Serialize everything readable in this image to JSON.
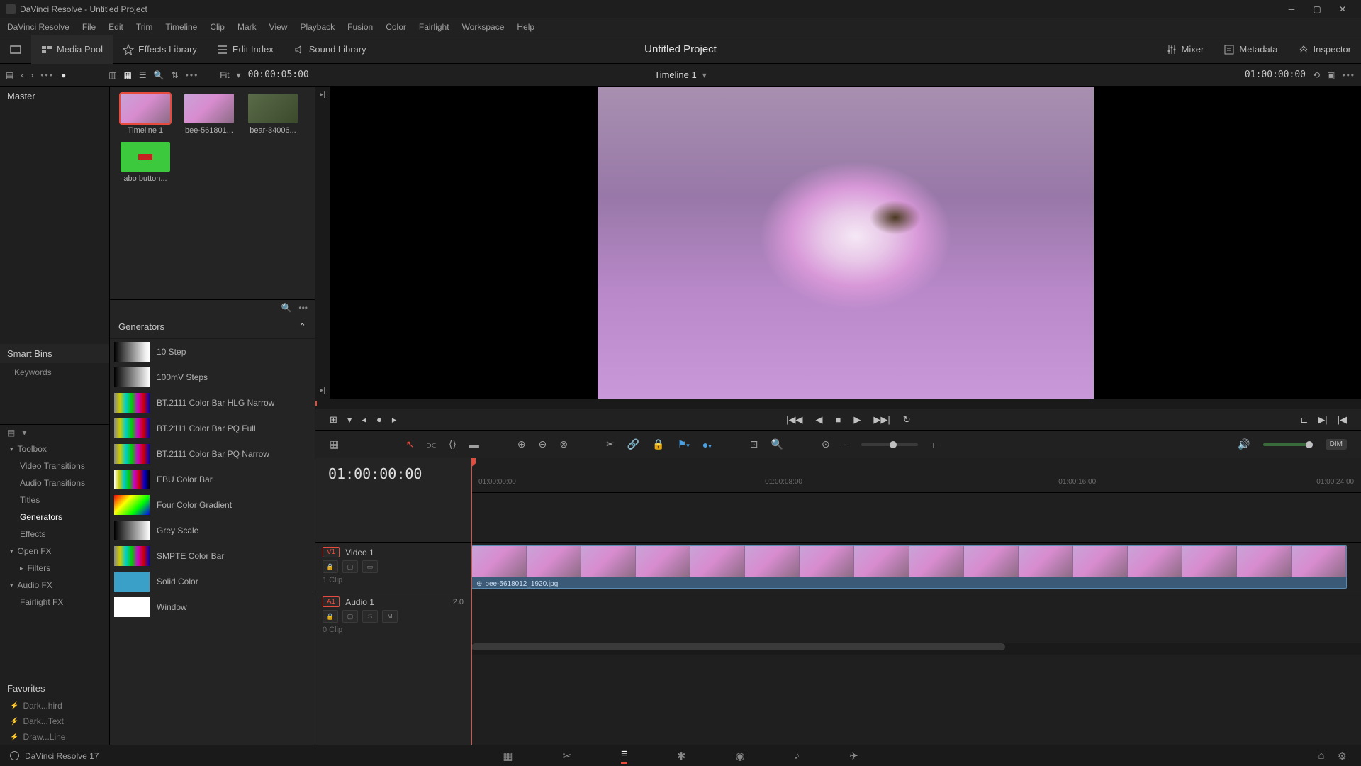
{
  "titlebar": {
    "text": "DaVinci Resolve - Untitled Project"
  },
  "menus": [
    "DaVinci Resolve",
    "File",
    "Edit",
    "Trim",
    "Timeline",
    "Clip",
    "Mark",
    "View",
    "Playback",
    "Fusion",
    "Color",
    "Fairlight",
    "Workspace",
    "Help"
  ],
  "top_tabs": {
    "left": [
      {
        "label": "Media Pool",
        "icon": "media-pool-icon"
      },
      {
        "label": "Effects Library",
        "icon": "effects-icon"
      },
      {
        "label": "Edit Index",
        "icon": "index-icon"
      },
      {
        "label": "Sound Library",
        "icon": "sound-icon"
      }
    ],
    "center": "Untitled Project",
    "right": [
      {
        "label": "Mixer",
        "icon": "mixer-icon"
      },
      {
        "label": "Metadata",
        "icon": "metadata-icon"
      },
      {
        "label": "Inspector",
        "icon": "inspector-icon"
      }
    ]
  },
  "subbar": {
    "fit": "Fit",
    "tc_left": "00:00:05:00",
    "timeline_name": "Timeline 1",
    "tc_right": "01:00:00:00"
  },
  "media": {
    "master": "Master",
    "smartbins": "Smart Bins",
    "keywords": "Keywords",
    "items": [
      {
        "label": "Timeline 1",
        "kind": "flower",
        "sel": true
      },
      {
        "label": "bee-561801...",
        "kind": "flower"
      },
      {
        "label": "bear-34006...",
        "kind": "bear"
      },
      {
        "label": "abo button...",
        "kind": "green"
      }
    ]
  },
  "toolbox": {
    "header": "Toolbox",
    "items": [
      "Video Transitions",
      "Audio Transitions",
      "Titles",
      "Generators",
      "Effects"
    ],
    "selected": "Generators",
    "openfx": "Open FX",
    "filters": "Filters",
    "audiofx": "Audio FX",
    "fairlightfx": "Fairlight FX"
  },
  "favorites": {
    "header": "Favorites",
    "items": [
      "Dark...hird",
      "Dark...Text",
      "Draw...Line"
    ]
  },
  "generators": {
    "header": "Generators",
    "items": [
      {
        "label": "10 Step",
        "sw": "linear-gradient(90deg,#000,#222,#444,#666,#888,#aaa,#ccc,#eee,#fff)"
      },
      {
        "label": "100mV Steps",
        "sw": "linear-gradient(90deg,#000,#fff)"
      },
      {
        "label": "BT.2111 Color Bar HLG Narrow",
        "sw": "linear-gradient(90deg,#888,#cc0,#0cc,#0c0,#c0c,#c00,#00c)"
      },
      {
        "label": "BT.2111 Color Bar PQ Full",
        "sw": "linear-gradient(90deg,#888,#cc0,#0cc,#0c0,#c0c,#c00,#00c)"
      },
      {
        "label": "BT.2111 Color Bar PQ Narrow",
        "sw": "linear-gradient(90deg,#888,#cc0,#0cc,#0c0,#c0c,#c00,#00c)"
      },
      {
        "label": "EBU Color Bar",
        "sw": "linear-gradient(90deg,#fff,#cc0,#0cc,#0c0,#c0c,#c00,#00c,#000)"
      },
      {
        "label": "Four Color Gradient",
        "sw": "linear-gradient(135deg,#f00,#ff0 33%,#0f0 66%,#00f)"
      },
      {
        "label": "Grey Scale",
        "sw": "linear-gradient(90deg,#000,#fff)"
      },
      {
        "label": "SMPTE Color Bar",
        "sw": "linear-gradient(90deg,#888,#cc0,#0cc,#0c0,#c0c,#c00,#00c)"
      },
      {
        "label": "Solid Color",
        "sw": "#3aa0c8"
      },
      {
        "label": "Window",
        "sw": "#fff"
      }
    ]
  },
  "timeline": {
    "tc": "01:00:00:00",
    "video_track": {
      "badge": "V1",
      "name": "Video 1",
      "clips": "1 Clip"
    },
    "audio_track": {
      "badge": "A1",
      "name": "Audio 1",
      "ch": "2.0",
      "clips": "0 Clip"
    },
    "clip_label": "bee-5618012_1920.jpg",
    "ruler": [
      "01:00:00:00",
      "01:00:08:00",
      "01:00:16:00",
      "01:00:24:00"
    ]
  },
  "status": {
    "version": "DaVinci Resolve 17",
    "dim": "DIM"
  }
}
